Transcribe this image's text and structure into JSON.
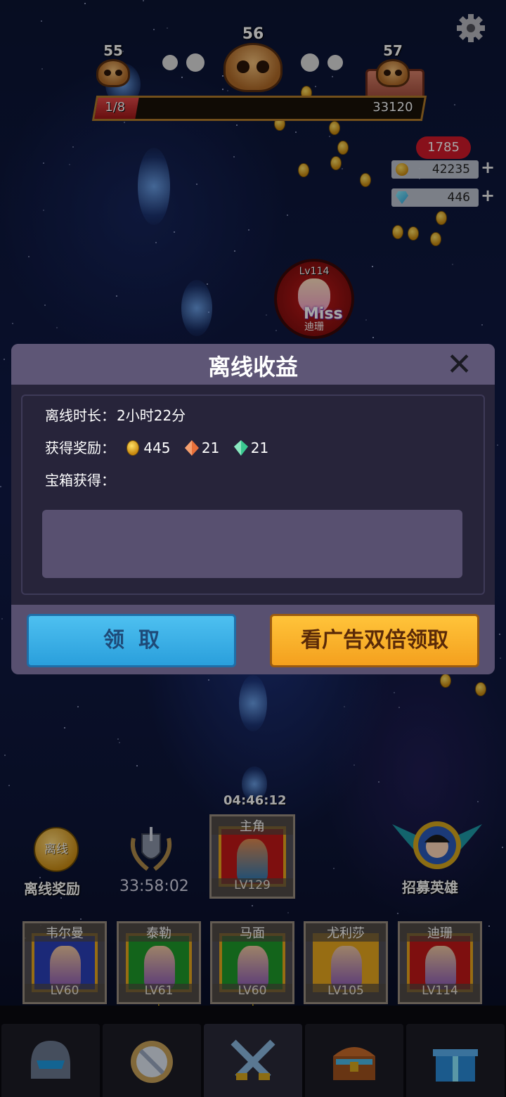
{
  "hud": {
    "stage_left": "55",
    "stage_current": "56",
    "stage_right": "57",
    "progress_label": "1/8",
    "progress_fraction": 0.125,
    "progress_value": "33120"
  },
  "currency": {
    "badge": "1785",
    "gold": "42235",
    "diamond": "446",
    "plus": "+"
  },
  "boss": {
    "level": "Lv114",
    "miss": "Miss",
    "name": "迪珊"
  },
  "dialog": {
    "title": "离线收益",
    "close": "✕",
    "duration_label": "离线时长：",
    "duration_value": "2小时22分",
    "reward_label": "获得奖励：",
    "reward_gold": "445",
    "reward_orange_gem": "21",
    "reward_green_gem": "21",
    "chest_label": "宝箱获得：",
    "claim_button": "领取",
    "ad_button": "看广告双倍领取"
  },
  "bottom": {
    "top_timer": "04:46:12",
    "offline_icon_text": "离线",
    "offline_caption": "离线奖励",
    "laurel_timer": "33:58:02",
    "recruit_caption": "招募英雄",
    "main_card": {
      "name": "主角",
      "level": "LV129",
      "color": "#c21818"
    },
    "heroes": [
      {
        "name": "韦尔曼",
        "level": "LV60",
        "color": "#2a3fb8"
      },
      {
        "name": "泰勒",
        "level": "LV61",
        "color": "#1e9a2a"
      },
      {
        "name": "马面",
        "level": "LV60",
        "color": "#1e9a2a"
      },
      {
        "name": "尤利莎",
        "level": "LV105",
        "color": "#e8a81e"
      },
      {
        "name": "迪珊",
        "level": "LV114",
        "color": "#c21818"
      }
    ]
  },
  "tabs": [
    {
      "icon": "helmet-icon"
    },
    {
      "icon": "shield-icon"
    },
    {
      "icon": "crossed-swords-icon"
    },
    {
      "icon": "treasure-chest-icon"
    },
    {
      "icon": "gift-box-icon"
    }
  ]
}
